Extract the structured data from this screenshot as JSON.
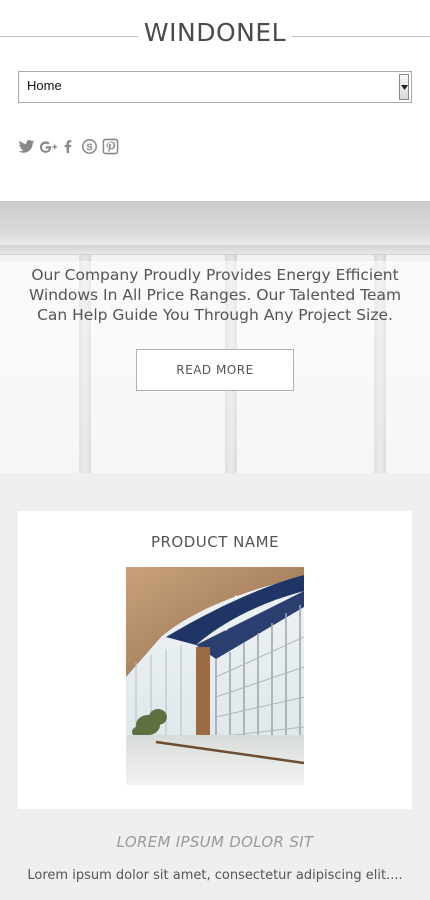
{
  "header": {
    "logo": "WINDONEL"
  },
  "nav": {
    "selected": "Home"
  },
  "social": {
    "icons": [
      "twitter-icon",
      "google-plus-icon",
      "facebook-icon",
      "skype-icon",
      "pinterest-icon"
    ]
  },
  "hero": {
    "text": "Our Company Proudly Provides Energy Efficient Windows In All Price Ranges. Our Talented Team Can Help Guide You Through Any Project Size.",
    "button_label": "READ MORE"
  },
  "product": {
    "title": "PRODUCT NAME",
    "subtitle": "LOREM IPSUM DOLOR SIT",
    "description": "Lorem ipsum dolor sit amet, consectetur adipiscing elit...."
  },
  "colors": {
    "text": "#555555",
    "background": "#efefef",
    "card": "#ffffff"
  }
}
